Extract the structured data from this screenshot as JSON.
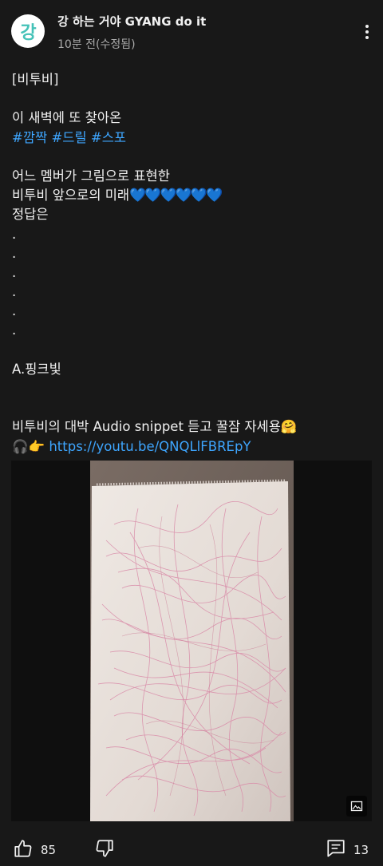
{
  "post": {
    "channel_name": "강 하는 거야 GYANG do it",
    "time": "10분 전(수정됨)",
    "avatar_text": "강"
  },
  "body": {
    "title": "[비투비]",
    "line_intro": "이 새벽에 또 찾아온",
    "tags": [
      "#깜짝",
      "#드릴",
      "#스포"
    ],
    "line_q1": "어느 멤버가 그림으로 표현한",
    "line_q2": "비투비 앞으로의 미래",
    "hearts": "💙💙💙💙💙💙",
    "line_answer_label": "정답은",
    "dots": [
      ".",
      ".",
      ".",
      ".",
      ".",
      "."
    ],
    "answer": "A.핑크빛",
    "promo": "비투비의 대박 Audio snippet 듣고 꿀잠 자세용",
    "promo_emoji": "🤗",
    "link_emojis": "🎧👉",
    "link": "https://youtu.be/QNQLlFBREpY"
  },
  "actions": {
    "like_count": "85",
    "comment_count": "13"
  },
  "colors": {
    "background": "#181818",
    "link": "#3ea6ff",
    "avatar_accent": "#45c2b8",
    "scribble": "#d98aa8"
  },
  "icons": {
    "more": "more-vert-icon",
    "like": "thumb-up-icon",
    "dislike": "thumb-down-icon",
    "comment": "comment-icon",
    "image": "image-icon"
  }
}
